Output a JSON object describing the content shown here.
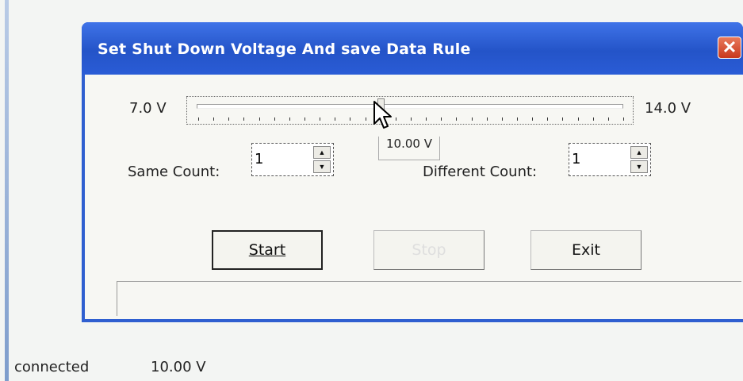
{
  "dialog": {
    "title": "Set Shut Down Voltage And save Data Rule",
    "close_label": "✕"
  },
  "slider": {
    "min_label": "7.0 V",
    "max_label": "14.0 V",
    "min": 7.0,
    "max": 14.0,
    "value": 10.0,
    "value_label": "10.00 V"
  },
  "same_count": {
    "label": "Same Count:",
    "value": "1"
  },
  "different_count": {
    "label": "Different Count:",
    "value": "1"
  },
  "buttons": {
    "start": "Start",
    "stop": "Stop",
    "exit": "Exit"
  },
  "statusbar": {
    "connection": "connected",
    "voltage": "10.00 V"
  }
}
